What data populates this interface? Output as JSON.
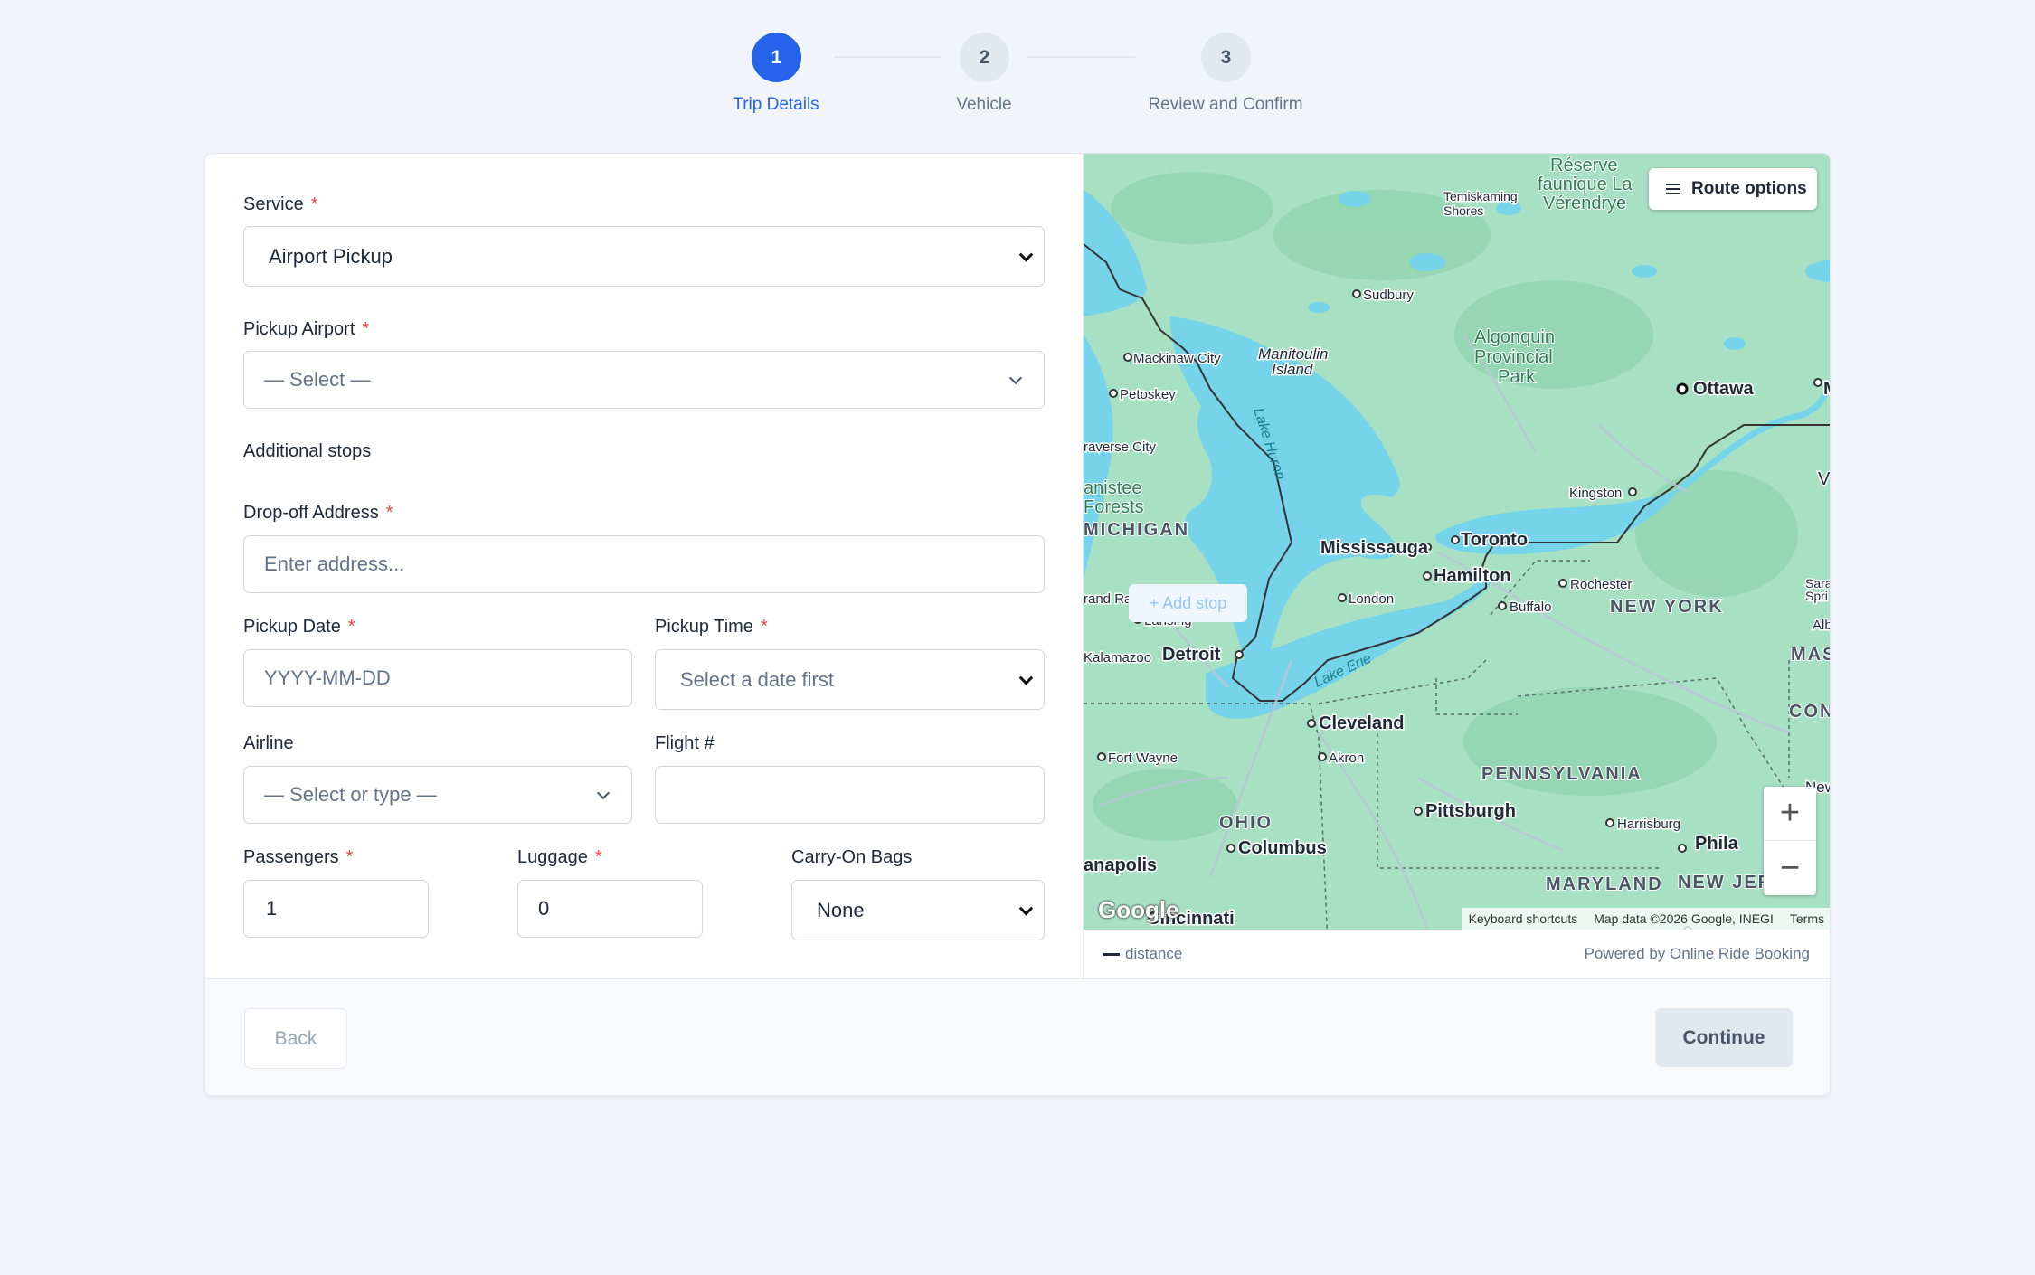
{
  "stepper": {
    "steps": [
      {
        "number": "1",
        "label": "Trip Details"
      },
      {
        "number": "2",
        "label": "Vehicle"
      },
      {
        "number": "3",
        "label": "Review and Confirm"
      }
    ],
    "active_step": 1
  },
  "form": {
    "service": {
      "label": "Service",
      "required": "*",
      "value": "Airport Pickup"
    },
    "pickup_airport": {
      "label": "Pickup Airport",
      "required": "*",
      "placeholder": "— Select —"
    },
    "additional_stops": {
      "label": "Additional stops",
      "add_label": "+ Add stop"
    },
    "dropoff_address": {
      "label": "Drop-off Address",
      "required": "*",
      "placeholder": "Enter address..."
    },
    "pickup_date": {
      "label": "Pickup Date",
      "required": "*",
      "placeholder": "YYYY-MM-DD"
    },
    "pickup_time": {
      "label": "Pickup Time",
      "required": "*",
      "value": "Select a date first"
    },
    "airline": {
      "label": "Airline",
      "placeholder": "— Select or type —"
    },
    "flight": {
      "label": "Flight #",
      "value": ""
    },
    "passengers": {
      "label": "Passengers",
      "required": "*",
      "value": "1"
    },
    "luggage": {
      "label": "Luggage",
      "required": "*",
      "value": "0"
    },
    "carry_on": {
      "label": "Carry-On Bags",
      "value": "None"
    }
  },
  "map": {
    "route_options_label": "Route options",
    "zoom_in": "+",
    "zoom_out": "−",
    "google_logo": "Google",
    "attribution": {
      "shortcuts": "Keyboard shortcuts",
      "data": "Map data ©2026 Google, INEGI",
      "terms": "Terms"
    },
    "legend_label": "distance",
    "powered_by": "Powered by Online Ride Booking",
    "places": {
      "ottawa": "Ottawa",
      "toronto": "Toronto",
      "mississauga": "Mississauga",
      "hamilton": "Hamilton",
      "buffalo": "Buffalo",
      "rochester": "Rochester",
      "kingston": "Kingston",
      "london": "London",
      "detroit": "Detroit",
      "cleveland": "Cleveland",
      "akron": "Akron",
      "pittsburgh": "Pittsburgh",
      "columbus": "Columbus",
      "cincinnati": "Cincinnati",
      "harrisburg": "Harrisburg",
      "sudbury": "Sudbury",
      "mackinaw": "Mackinaw City",
      "petoskey": "Petoskey",
      "traverse": "raverse City",
      "lansing": "Lansing",
      "grand_rapids": "rand Rapids",
      "kalamazoo": "Kalamazoo",
      "fort_wayne": "Fort Wayne",
      "indianapolis": "anapolis",
      "temiskaming_1": "Temiskaming",
      "temiskaming_2": "Shores",
      "manitoulin_1": "Manitoulin",
      "manitoulin_2": "Island",
      "algonquin_1": "Algonquin",
      "algonquin_2": "Provincial",
      "algonquin_3": "Park",
      "reserve_1": "Réserve",
      "reserve_2": "faunique La",
      "reserve_3": "Vérendrye",
      "manistee_1": "anistee",
      "manistee_2": "Forests",
      "lake_huron": "Lake Huron",
      "lake_erie": "Lake Erie",
      "philadelphia": "Phila",
      "edge_m": "M",
      "edge_v": "V",
      "edge_sara_1": "Sara",
      "edge_sara_2": "Spri",
      "edge_alb": "Alb",
      "edge_new": "New",
      "state_michigan": "MICHIGAN",
      "state_new_york": "NEW YORK",
      "state_pennsylvania": "PENNSYLVANIA",
      "state_ohio": "OHIO",
      "state_maryland": "MARYLAND",
      "state_new_jersey": "NEW JEF",
      "state_mass": "MAS",
      "state_conn": "CON"
    }
  },
  "footer": {
    "back_label": "Back",
    "continue_label": "Continue"
  },
  "colors": {
    "accent": "#2563eb",
    "required": "#ef4444",
    "map_land": "#a8e0c3",
    "map_water": "#75d4ea"
  }
}
